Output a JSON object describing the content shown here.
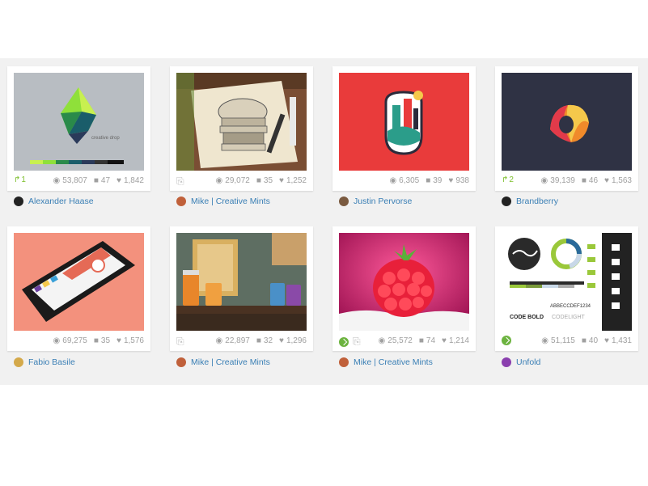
{
  "shots": [
    {
      "rebound": "1",
      "views": "53,807",
      "comments": "47",
      "likes": "1,842",
      "author": "Alexander Haase",
      "caption": "creative drop",
      "avatar": "#222222"
    },
    {
      "views": "29,072",
      "comments": "35",
      "likes": "1,252",
      "author": "Mike | Creative Mints",
      "avatar": "#c0603a"
    },
    {
      "views": "6,305",
      "comments": "39",
      "likes": "938",
      "author": "Justin Pervorse",
      "avatar": "#7a5a40"
    },
    {
      "rebound": "2",
      "views": "39,139",
      "comments": "46",
      "likes": "1,563",
      "author": "Brandberry",
      "avatar": "#222222"
    },
    {
      "views": "69,275",
      "comments": "35",
      "likes": "1,576",
      "author": "Fabio Basile",
      "avatar": "#d4a94a"
    },
    {
      "views": "22,897",
      "comments": "32",
      "likes": "1,296",
      "author": "Mike | Creative Mints",
      "avatar": "#c0603a"
    },
    {
      "views": "25,572",
      "comments": "74",
      "likes": "1,214",
      "author": "Mike | Creative Mints",
      "avatar": "#c0603a"
    },
    {
      "views": "51,115",
      "comments": "40",
      "likes": "1,431",
      "author": "Unfold",
      "avatar": "#8a3fae",
      "lines": [
        "ABBECCDEF1234",
        "CODE BOLD",
        "CODELIGHT"
      ]
    }
  ],
  "colors": {
    "link": "#3a7fb5",
    "meta": "#a0a0a0",
    "band": "#f1f1f1",
    "rebound": "#7cbf2b"
  }
}
